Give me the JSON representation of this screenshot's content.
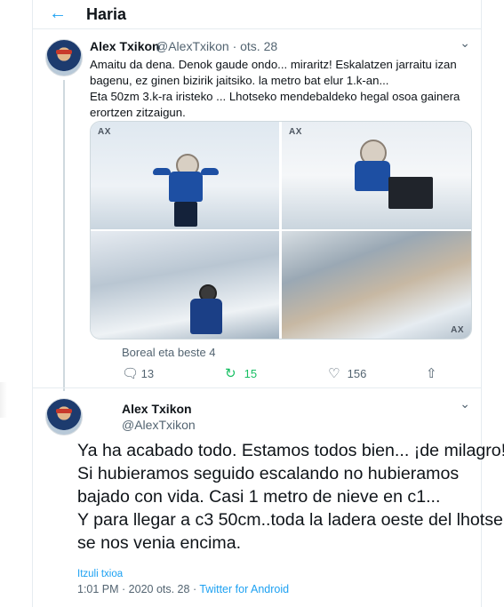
{
  "header": {
    "back_icon": "arrow-left-icon",
    "title": "Haria"
  },
  "tweet1": {
    "name": "Alex Txikon",
    "handle": "@AlexTxikon · ots. 28",
    "more_icon": "chevron-down-icon",
    "text": [
      "Amaitu da dena. Denok gaude ondo... miraritz! Eskalatzen jarraitu izan",
      "bagenu, ez ginen bizirik jaitsiko. la metro bat elur 1.k-an...",
      "Eta 50zm 3.k-ra iristeko ... Lhotseko mendebaldeko hegal osoa gainera",
      "erortzen zitzaigun."
    ],
    "photo_watermark": "AX",
    "tagged": "Boreal eta beste 4",
    "actions": {
      "reply_icon": "reply-icon",
      "reply_count": "13",
      "retweet_icon": "retweet-icon",
      "retweet_count": "15",
      "like_icon": "heart-icon",
      "like_count": "156",
      "share_icon": "share-icon"
    }
  },
  "tweet2": {
    "name": "Alex Txikon",
    "handle": "@AlexTxikon",
    "text": [
      "Ya ha acabado todo. Estamos todos bien... ¡de milagro!",
      "Si hubieramos seguido escalando no hubieramos",
      "bajado con vida. Casi 1 metro de nieve en c1...",
      "Y para llegar a c3 50cm..toda la ladera oeste del lhotse",
      "se nos venia encima."
    ],
    "translate": "Itzuli txioa",
    "meta_time": "1:01 PM · 2020 ots. 28 · ",
    "meta_source": "Twitter for Android"
  },
  "colors": {
    "accent": "#1da1f2",
    "retweet": "#17bf63",
    "muted": "#536471"
  }
}
